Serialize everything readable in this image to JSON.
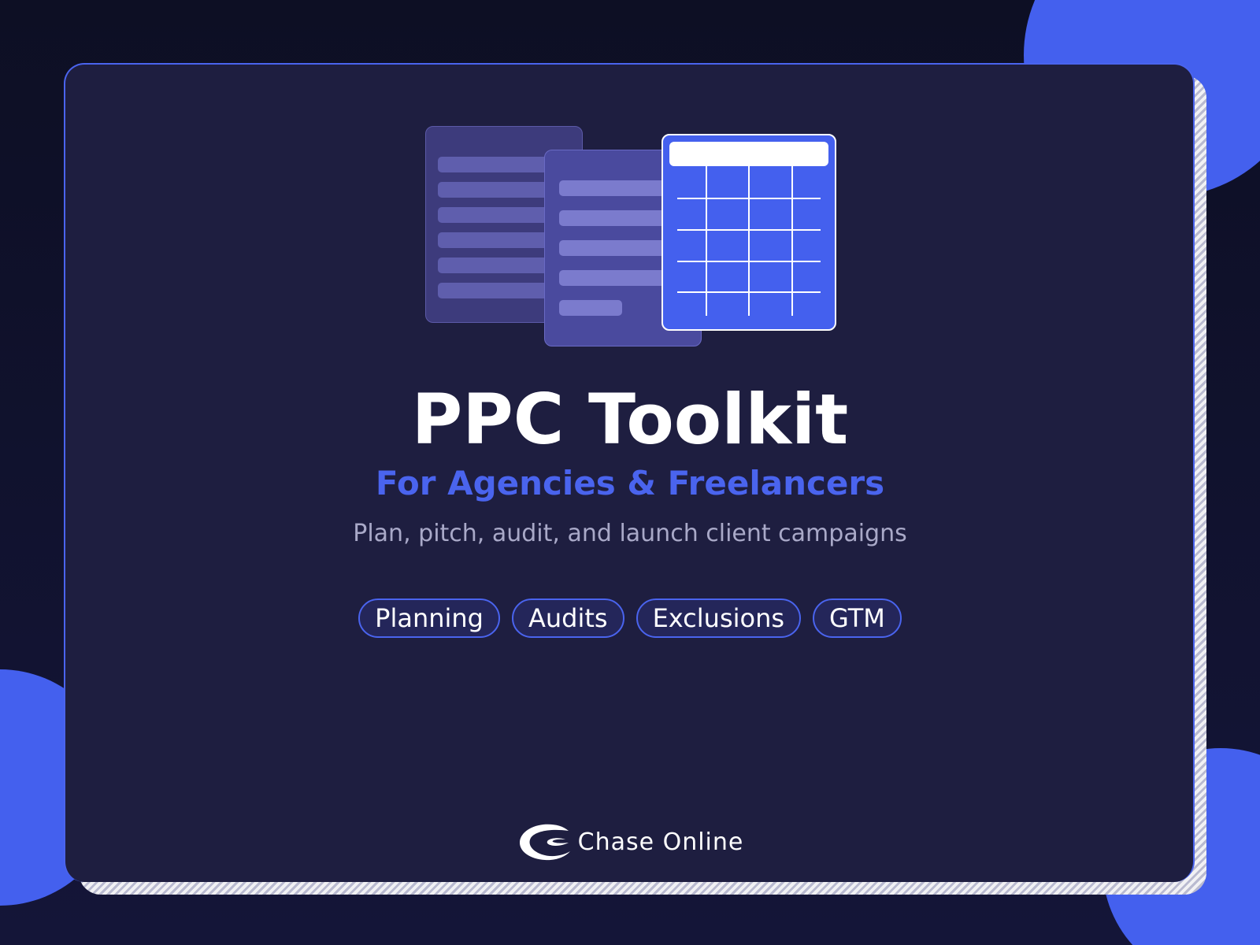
{
  "colors": {
    "background": "#0d0f24",
    "card": "#1e1e40",
    "accent": "#4a64ee",
    "blob": "#4460ee",
    "tag_fill": "#24265a",
    "title": "#ffffff",
    "tagline": "#a9a9c8"
  },
  "hero": {
    "title": "PPC Toolkit",
    "subtitle": "For Agencies & Freelancers",
    "tagline": "Plan, pitch, audit, and launch client campaigns"
  },
  "tags": [
    {
      "label": "Planning"
    },
    {
      "label": "Audits"
    },
    {
      "label": "Exclusions"
    },
    {
      "label": "GTM"
    }
  ],
  "illustration": {
    "icons": [
      "document-icon",
      "document-icon",
      "spreadsheet-icon"
    ]
  },
  "brand": {
    "name": "Chase Online",
    "logo_icon": "chase-online-logo-icon"
  }
}
